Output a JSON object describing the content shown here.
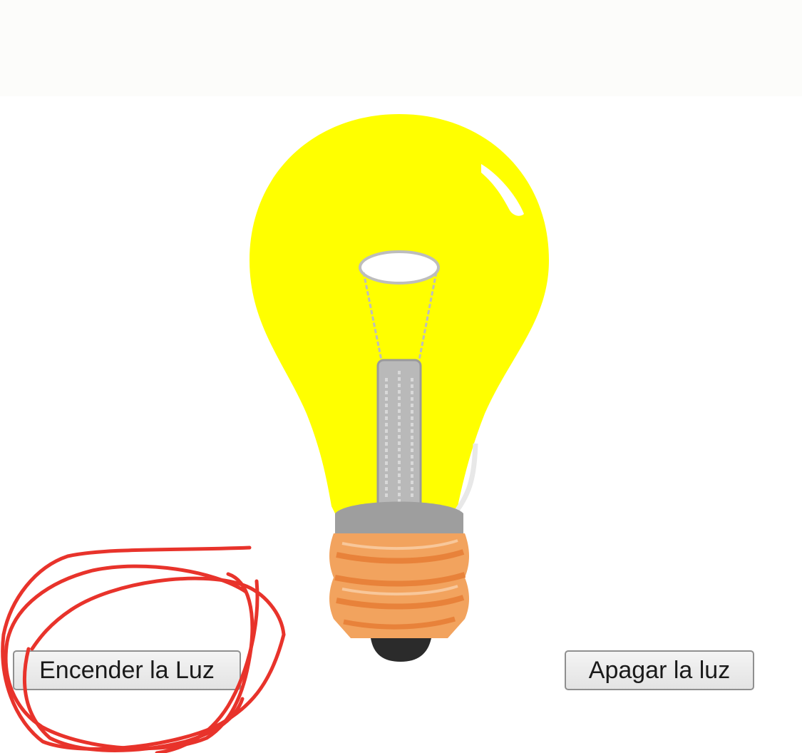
{
  "buttons": {
    "turn_on_label": "Encender la Luz",
    "turn_off_label": "Apagar la luz"
  },
  "illustration": {
    "icon": "light-bulb-icon",
    "state": "on"
  },
  "annotation": {
    "icon": "red-scribble-circle",
    "color": "#e8332b"
  },
  "colors": {
    "bulb_glass": "#ffff00",
    "bulb_base": "#f2a35e",
    "filament": "#b9b9b9",
    "tip": "#2b2b2b"
  }
}
